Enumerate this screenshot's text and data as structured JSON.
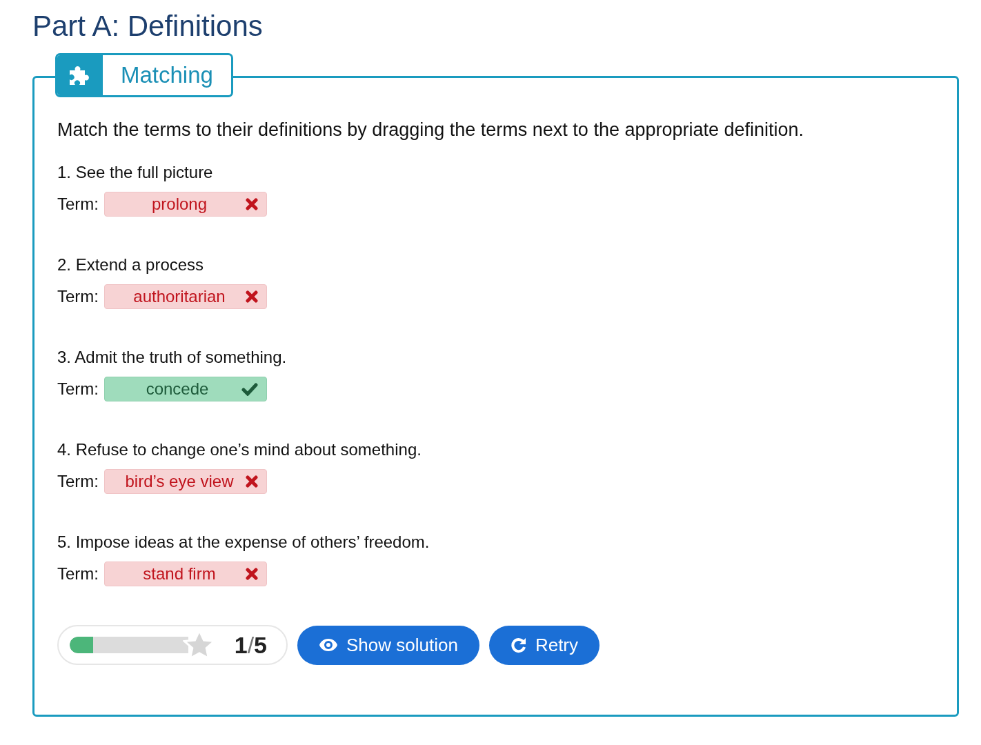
{
  "heading": "Part A: Definitions",
  "tab": {
    "label": "Matching"
  },
  "instructions": "Match the terms to their definitions by dragging the terms next to the appropriate definition.",
  "items": [
    {
      "definition": "1. See the full picture",
      "term_label": "Term:",
      "term": "prolong",
      "correct": false
    },
    {
      "definition": "2. Extend a process",
      "term_label": "Term:",
      "term": "authoritarian",
      "correct": false
    },
    {
      "definition": "3. Admit the truth of something.",
      "term_label": "Term:",
      "term": "concede",
      "correct": true
    },
    {
      "definition": "4. Refuse to change one’s mind about something.",
      "term_label": "Term:",
      "term": "bird’s eye view",
      "correct": false
    },
    {
      "definition": "5. Impose ideas at the expense of others’ freedom.",
      "term_label": "Term:",
      "term": "stand firm",
      "correct": false
    }
  ],
  "score": {
    "level": 0.2,
    "value": "1",
    "separator": "/",
    "max": "5"
  },
  "buttons": [
    {
      "kind": "solution",
      "label": "Show solution"
    },
    {
      "kind": "retry",
      "label": "Retry"
    }
  ]
}
